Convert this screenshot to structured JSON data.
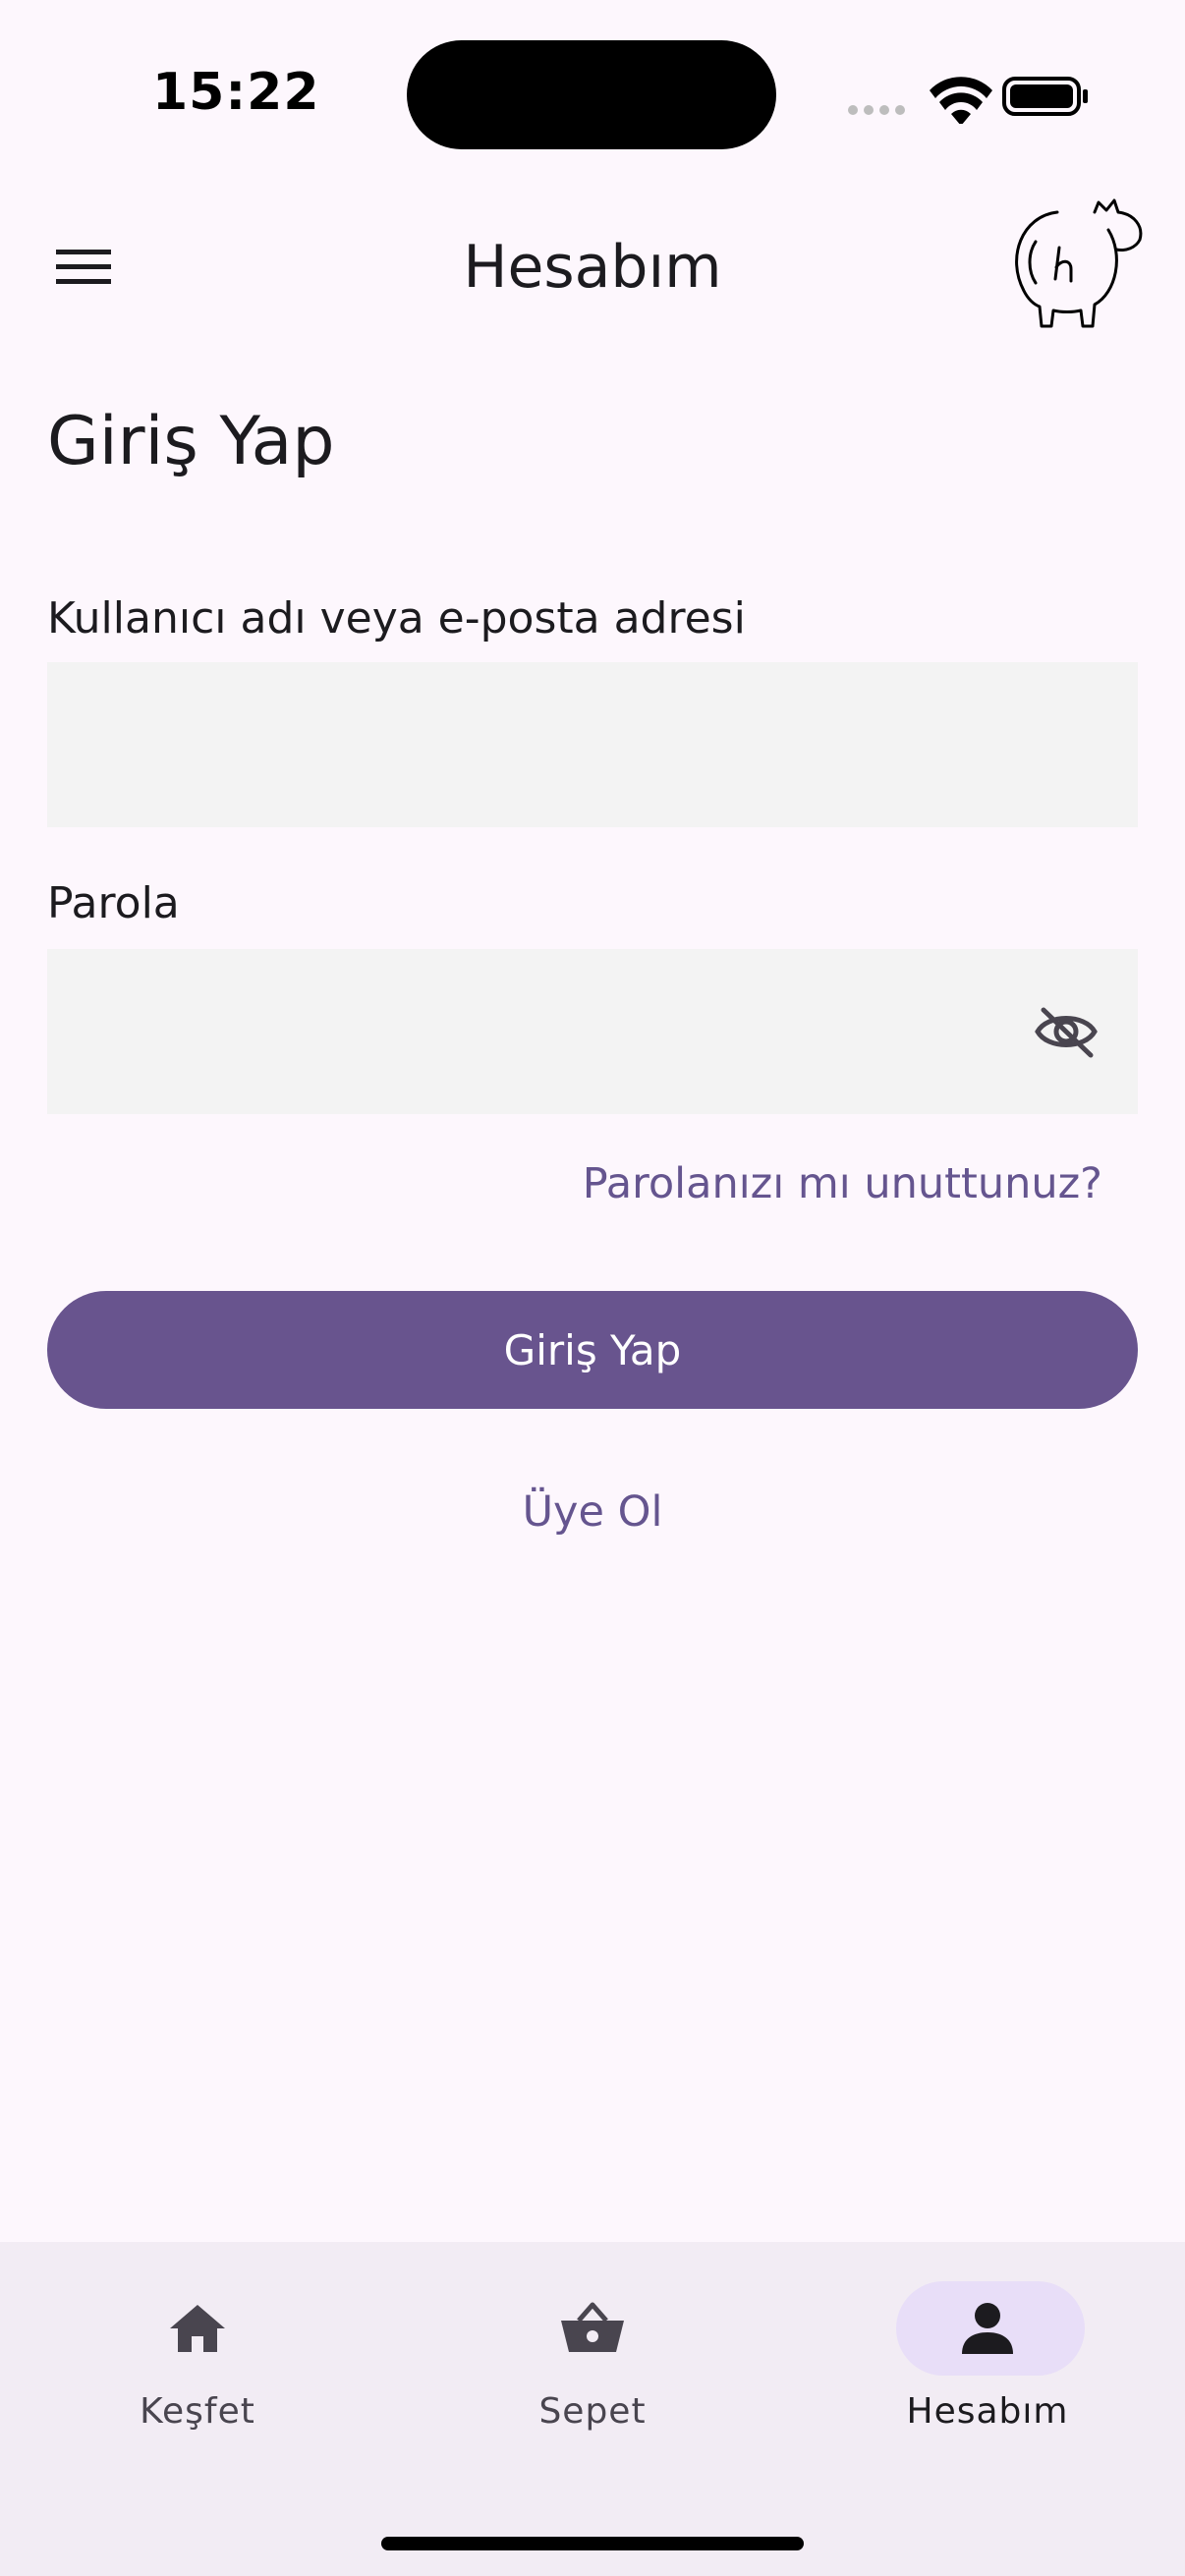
{
  "status_bar": {
    "time": "15:22"
  },
  "app_bar": {
    "title": "Hesabım",
    "menu_icon": "menu-icon",
    "logo_icon": "brand-logo-icon"
  },
  "login": {
    "heading": "Giriş Yap",
    "username_label": "Kullanıcı adı veya e-posta adresi",
    "username_value": "",
    "password_label": "Parola",
    "password_value": "",
    "password_toggle_icon": "visibility-off-icon",
    "forgot_password": "Parolanızı mı unuttunuz?",
    "submit_label": "Giriş Yap",
    "signup_label": "Üye Ol"
  },
  "bottom_nav": {
    "items": [
      {
        "label": "Keşfet",
        "icon": "home-icon",
        "active": false
      },
      {
        "label": "Sepet",
        "icon": "basket-icon",
        "active": false
      },
      {
        "label": "Hesabım",
        "icon": "person-icon",
        "active": true
      }
    ]
  },
  "colors": {
    "background": "#FDF7FD",
    "primary": "#68548E",
    "link": "#65558F",
    "field_background": "#F3F3F3",
    "nav_background": "#F2ECF4",
    "active_pill": "#E8DEF8"
  }
}
